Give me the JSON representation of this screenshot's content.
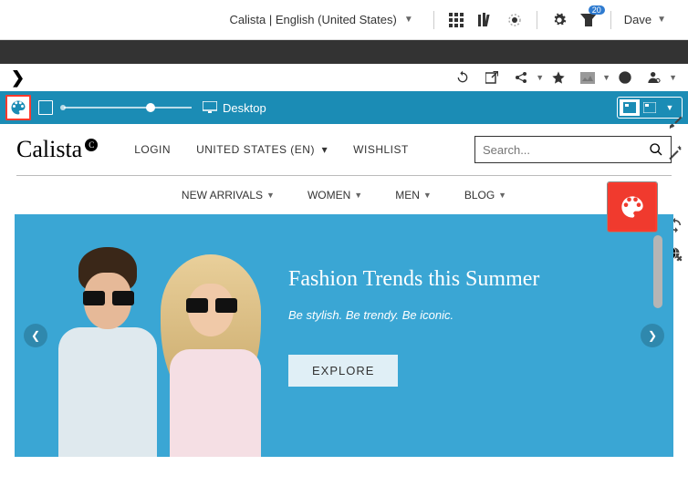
{
  "topbar": {
    "site_label": "Calista | English (United States)",
    "user_name": "Dave",
    "notif_count": "20"
  },
  "bluebar": {
    "mode_label": "Desktop"
  },
  "site": {
    "logo_text": "Calista",
    "logo_badge": "C",
    "nav": {
      "login": "LOGIN",
      "locale": "UNITED STATES (EN)",
      "wishlist": "WISHLIST"
    },
    "search_placeholder": "Search..."
  },
  "categories": {
    "new": "NEW ARRIVALS",
    "women": "WOMEN",
    "men": "MEN",
    "blog": "BLOG"
  },
  "hero": {
    "title": "Fashion Trends this Summer",
    "subtitle_a": "Be stylish. Be trendy. Be iconic.",
    "cta": "EXPLORE"
  }
}
